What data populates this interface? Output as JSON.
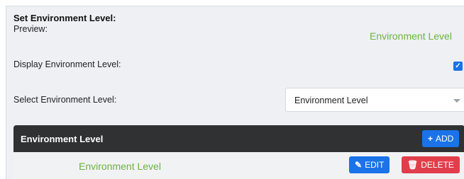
{
  "section": {
    "title": "Set Environment Level:"
  },
  "preview": {
    "label": "Preview:",
    "value": "Environment Level"
  },
  "display": {
    "label": "Display Environment Level:",
    "checked_glyph": "✓",
    "checked": true
  },
  "select": {
    "label": "Select Environment Level:",
    "value": "Environment Level"
  },
  "table": {
    "title": "Environment Level",
    "add_label": "ADD",
    "rows": [
      {
        "name": "Environment Level",
        "edit_label": "EDIT",
        "delete_label": "DELETE"
      }
    ]
  },
  "colors": {
    "accent": "#1a73e8",
    "danger": "#e03e4a",
    "green_text": "#6db33f",
    "header_bg": "#2f3133",
    "panel_bg": "#eef0f4"
  },
  "icons": {
    "add": "plus-icon",
    "edit": "pencil-icon",
    "delete": "trash-icon",
    "dropdown": "caret-down-icon",
    "check": "check-icon"
  }
}
